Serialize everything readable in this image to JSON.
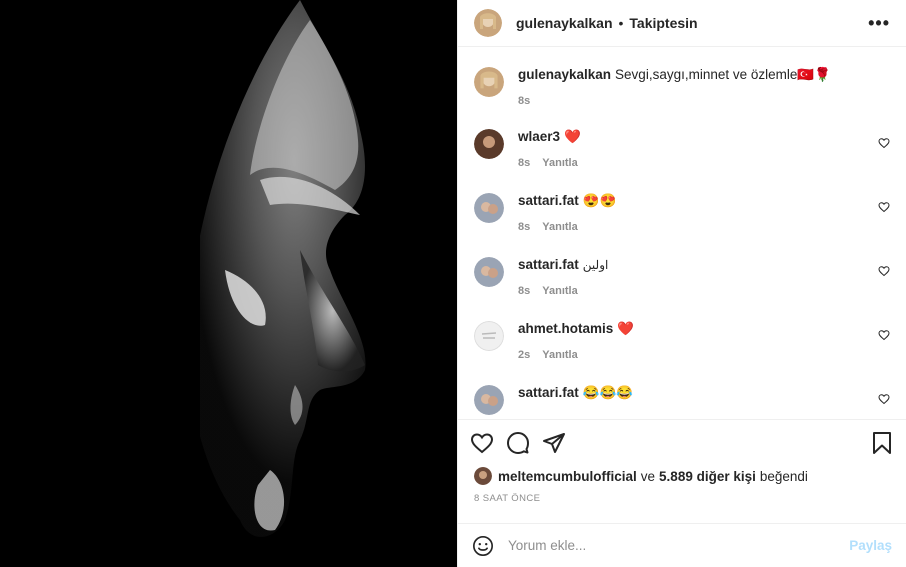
{
  "post": {
    "author": "gulenaykalkan",
    "follow_status": "Takiptesin",
    "separator": "•"
  },
  "caption": {
    "user": "gulenaykalkan",
    "text": "Sevgi,saygı,minnet ve özlemle🇹🇷🌹",
    "age": "8s"
  },
  "comments": [
    {
      "user": "wlaer3",
      "text": "❤️",
      "age": "8s",
      "reply": "Yanıtla"
    },
    {
      "user": "sattari.fat",
      "text": "😍😍",
      "age": "8s",
      "reply": "Yanıtla"
    },
    {
      "user": "sattari.fat",
      "text": "اولین",
      "age": "8s",
      "reply": "Yanıtla"
    },
    {
      "user": "ahmet.hotamis",
      "text": "❤️",
      "age": "2s",
      "reply": "Yanıtla"
    },
    {
      "user": "sattari.fat",
      "text": "😂😂😂",
      "age": "",
      "reply": ""
    }
  ],
  "likes": {
    "user": "meltemcumbulofficial",
    "connector": "ve",
    "count": "5.889 diğer kişi",
    "suffix": "beğendi"
  },
  "timestamp": "8 SAAT ÖNCE",
  "comment_box": {
    "placeholder": "Yorum ekle...",
    "post_label": "Paylaş"
  },
  "icons": {
    "more": "more-icon",
    "like": "heart-icon",
    "comment": "comment-icon",
    "share": "share-icon",
    "save": "bookmark-icon",
    "emoji": "emoji-icon"
  },
  "colors": {
    "text": "#262626",
    "muted": "#8e8e8e",
    "border": "#efefef",
    "post_button": "#b2dffc",
    "heart": "#ed4956"
  }
}
